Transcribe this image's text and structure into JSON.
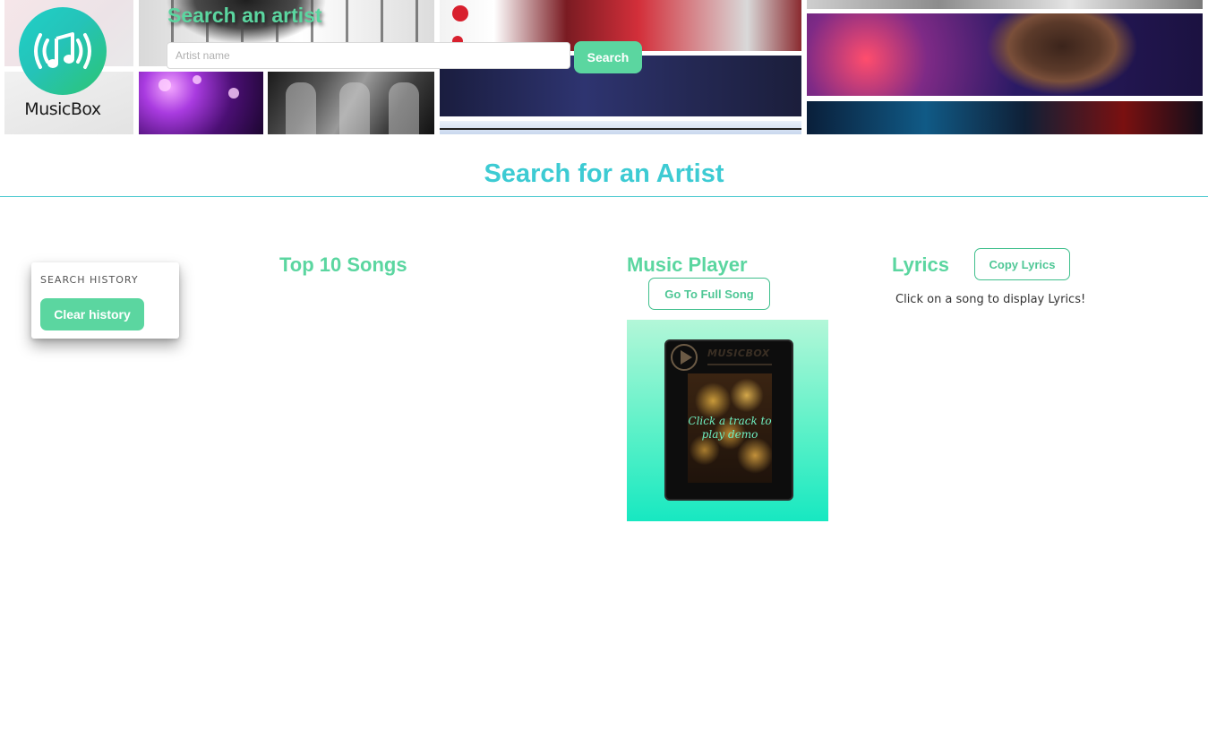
{
  "header": {
    "logo_text": "MusicBox",
    "hero_title": "Search an artist",
    "search_placeholder": "Artist name",
    "search_value": "",
    "search_button": "Search"
  },
  "page_title": "Search for an Artist",
  "history": {
    "label": "SEARCH HISTORY",
    "clear_button": "Clear history"
  },
  "top_songs": {
    "title": "Top 10 Songs"
  },
  "player": {
    "title": "Music Player",
    "full_song_button": "Go To Full Song",
    "device_brand": "MUSICBOX",
    "device_text": "Click a track to play demo"
  },
  "lyrics": {
    "title": "Lyrics",
    "copy_button": "Copy Lyrics",
    "hint": "Click on a song to display Lyrics!"
  },
  "colors": {
    "accent_green": "#5bd6a0",
    "accent_teal": "#3dcbd3"
  },
  "icons": {
    "logo": "music-note-broadcast-icon",
    "player_play": "play-icon"
  }
}
